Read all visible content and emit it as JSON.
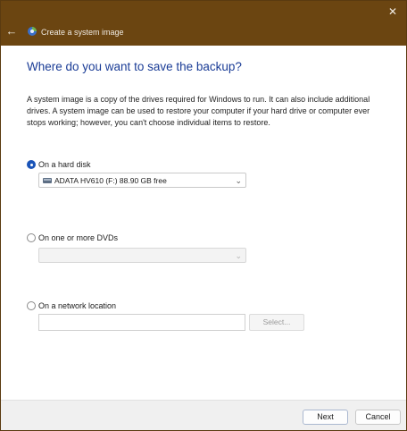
{
  "window": {
    "title": "Create a system image",
    "close_glyph": "✕",
    "back_glyph": "←"
  },
  "heading": "Where do you want to save the backup?",
  "description": "A system image is a copy of the drives required for Windows to run. It can also include additional drives. A system image can be used to restore your computer if your hard drive or computer ever stops working; however, you can't choose individual items to restore.",
  "options": {
    "hard_disk": {
      "label": "On a hard disk",
      "checked": true,
      "selected_value": "ADATA HV610 (F:)  88.90 GB free"
    },
    "dvds": {
      "label": "On one or more DVDs",
      "checked": false,
      "selected_value": ""
    },
    "network": {
      "label": "On a network location",
      "checked": false,
      "path_value": "",
      "select_label": "Select..."
    }
  },
  "footer": {
    "next_label": "Next",
    "cancel_label": "Cancel"
  },
  "icons": {
    "back": "back-arrow-icon",
    "app": "system-backup-icon",
    "close": "close-icon",
    "drive": "hard-drive-icon",
    "chevron": "chevron-down-icon"
  },
  "colors": {
    "titlebar": "#6b4511",
    "heading": "#1a3c96",
    "accent": "#1a54b8"
  }
}
